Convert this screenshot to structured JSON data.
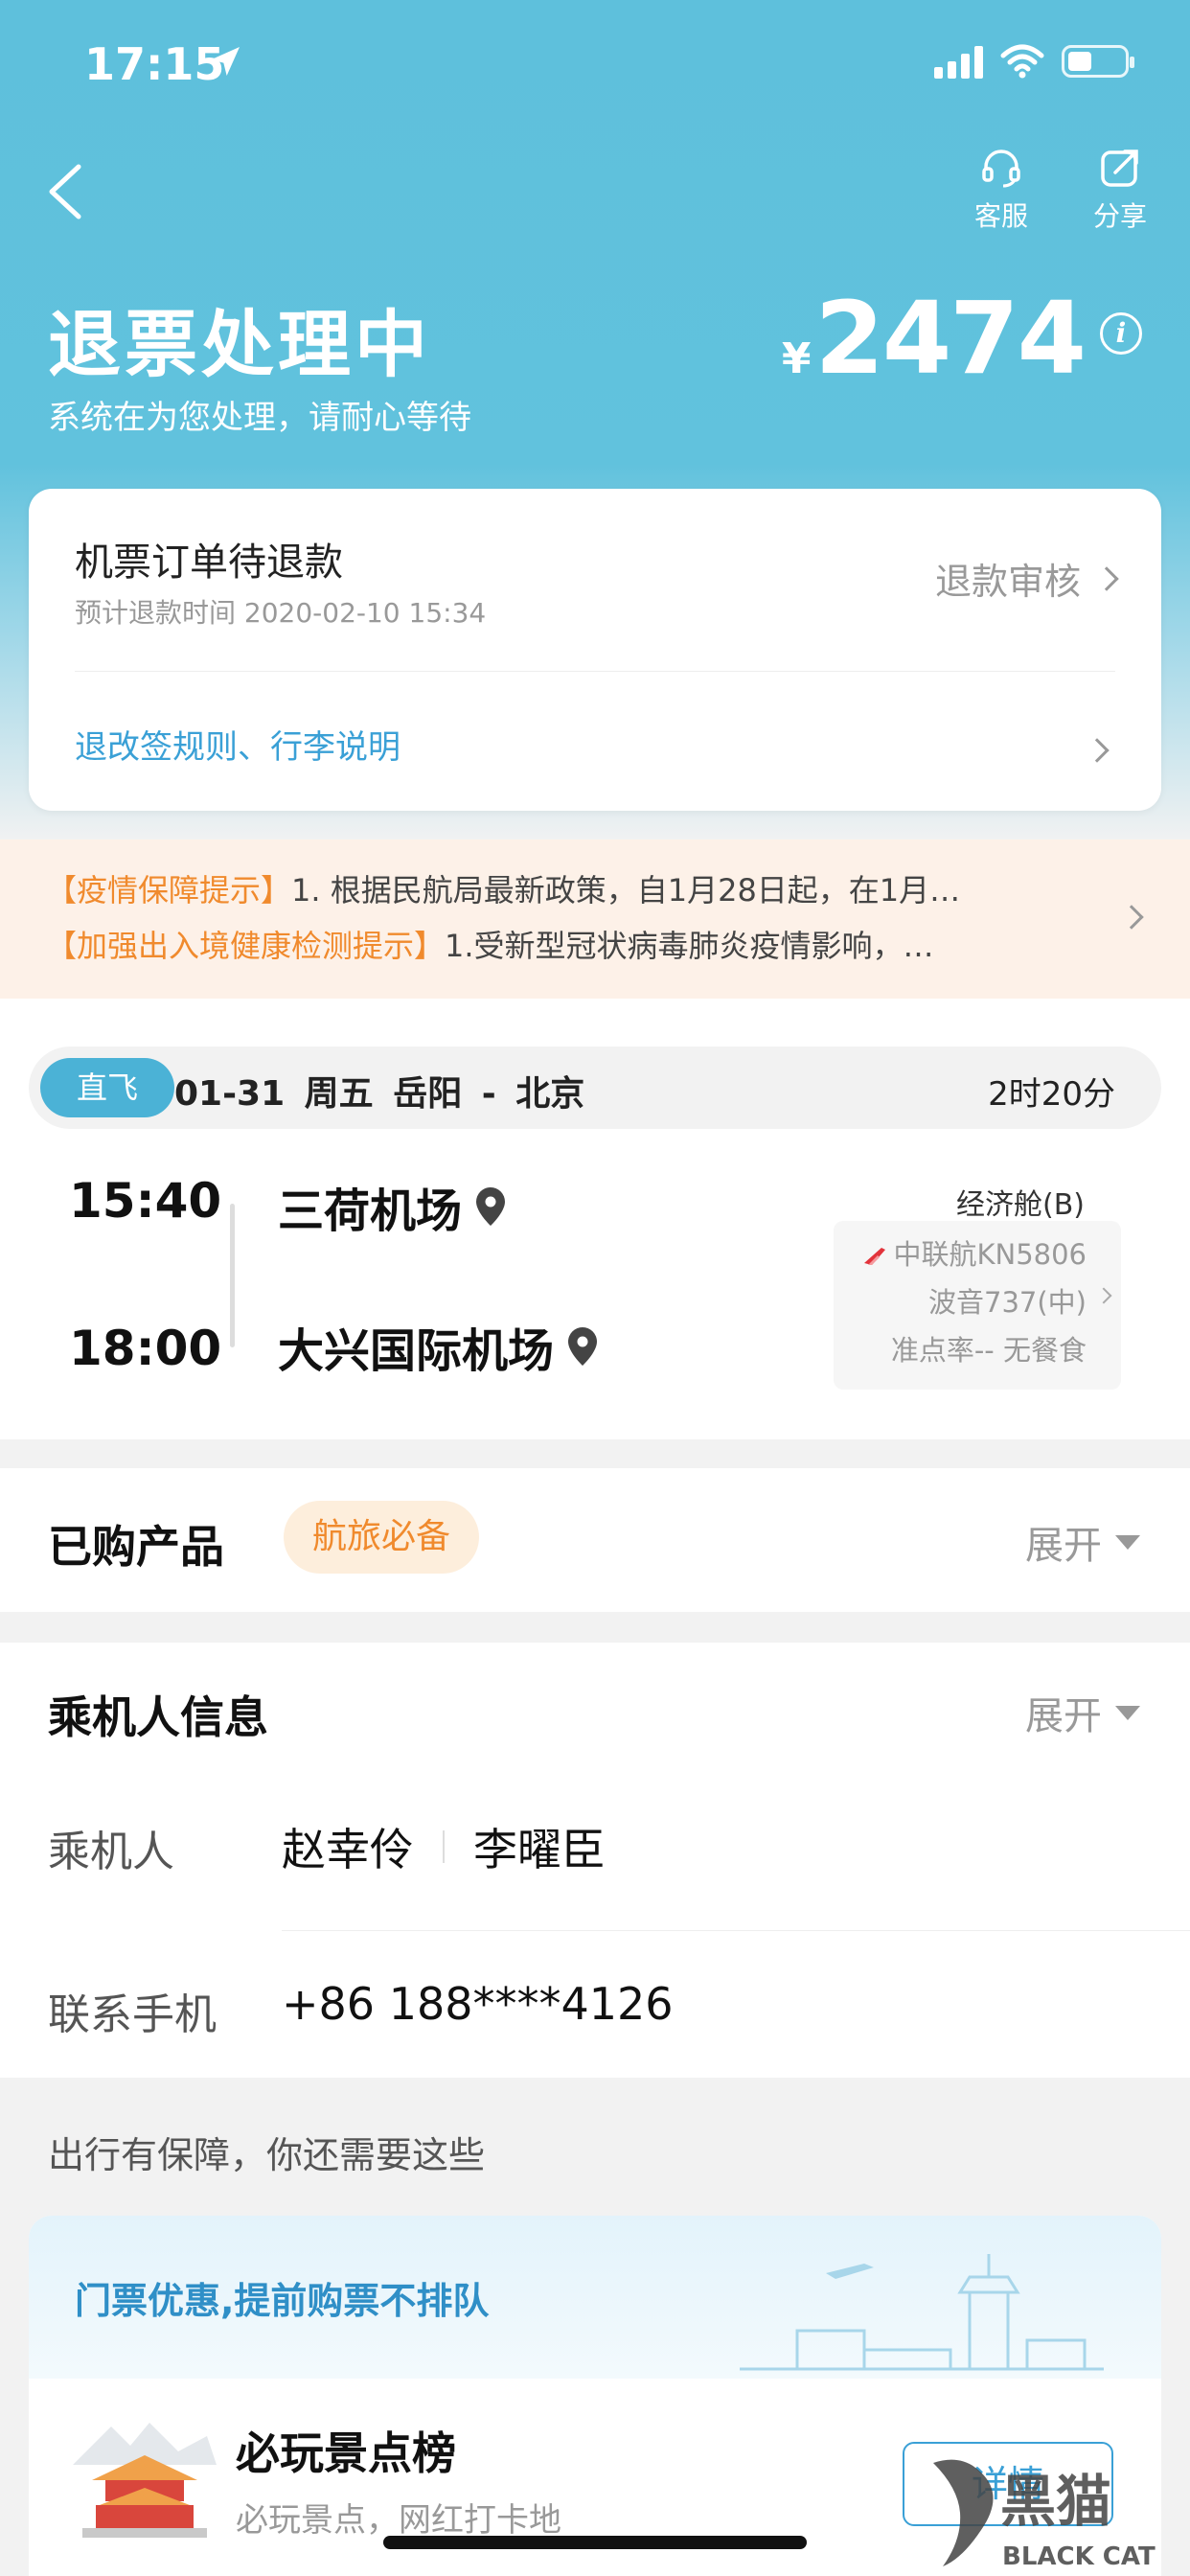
{
  "status_bar": {
    "time": "17:15"
  },
  "header": {
    "service_label": "客服",
    "share_label": "分享",
    "title": "退票处理中",
    "subtitle": "系统在为您处理，请耐心等待",
    "currency": "¥",
    "amount": "2474"
  },
  "refund_card": {
    "title": "机票订单待退款",
    "estimate": "预计退款时间 2020-02-10 15:34",
    "status": "退款审核",
    "rules_link": "退改签规则、行李说明"
  },
  "notices": [
    {
      "tag": "【疫情保障提示】",
      "text": "1. 根据民航局最新政策，自1月28日起，在1月…"
    },
    {
      "tag": "【加强出入境健康检测提示】",
      "text": "1.受新型冠状病毒肺炎疫情影响，…"
    }
  ],
  "flight": {
    "badge": "直飞",
    "summary": "01-31 周五 岳阳 - 北京",
    "duration": "2时20分",
    "dep_time": "15:40",
    "dep_airport": "三荷机场",
    "arr_time": "18:00",
    "arr_airport": "大兴国际机场",
    "cabin": "经济舱(B)",
    "flight_no": "中联航KN5806",
    "aircraft": "波音737(中)",
    "punctuality": "准点率-- 无餐食"
  },
  "purchased": {
    "title": "已购产品",
    "tag": "航旅必备",
    "expand": "展开"
  },
  "passengers": {
    "title": "乘机人信息",
    "expand": "展开",
    "passenger_label": "乘机人",
    "passenger_1": "赵幸伶",
    "passenger_2": "李曜臣",
    "phone_label": "联系手机",
    "phone": "+86 188****4126"
  },
  "promo": {
    "hint": "出行有保障，你还需要这些",
    "banner": "门票优惠,提前购票不排队",
    "item_title": "必玩景点榜",
    "item_sub": "必玩景点，网红打卡地",
    "detail_btn": "详情"
  },
  "watermark": {
    "cn": "黑猫",
    "en": "BLACK CAT"
  },
  "colors": {
    "accent": "#5ec0dc",
    "link": "#3aa0d6",
    "warning": "#f08a2d"
  }
}
